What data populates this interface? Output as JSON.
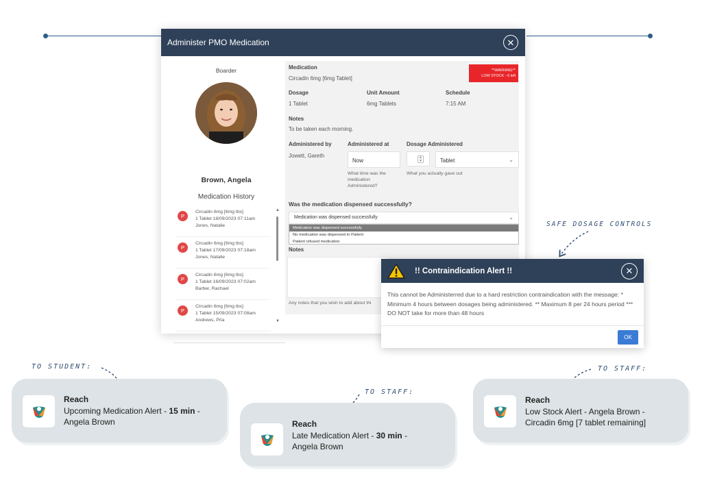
{
  "modal": {
    "title": "Administer PMO Medication",
    "close_icon": "close-icon",
    "boarder_label": "Boarder",
    "student_name": "Brown, Angela",
    "history_title": "Medication History",
    "history": [
      {
        "badge": "P",
        "line1": "Circadin 6mg [6mg tbs]",
        "line2": "1 Tablet 18/09/2023 07:11am",
        "line3": "Jones, Natalie"
      },
      {
        "badge": "P",
        "line1": "Circadin 6mg [6mg tbs]",
        "line2": "1 Tablet 17/09/2023 07:18am",
        "line3": "Jones, Natalie"
      },
      {
        "badge": "P",
        "line1": "Circadin 6mg [6mg tbs]",
        "line2": "1 Tablet 16/09/2023 07:02am",
        "line3": "Barber, Rachael"
      },
      {
        "badge": "P",
        "line1": "Circadin 6mg [6mg tbs]",
        "line2": "1 Tablet 15/09/2023 07:08am",
        "line3": "Andrews, Pria"
      }
    ],
    "medication_label": "Medication",
    "medication_value": "Circadin 6mg [6mg Tablet]",
    "warning_line1": "**WARNING**",
    "warning_line2": "LOW STOCK - 6 left",
    "dosage_label": "Dosage",
    "dosage_value": "1 Tablet",
    "unit_label": "Unit Amount",
    "unit_value": "6mg Tablets",
    "schedule_label": "Schedule",
    "schedule_value": "7:15 AM",
    "notes_label": "Notes",
    "notes_value": "To be taken each morning.",
    "admin_by_label": "Administered by",
    "admin_by_value": "Jowett, Gareth",
    "admin_at_label": "Administered at",
    "admin_at_value": "Now",
    "admin_at_hint": "What time was the medication Administered?",
    "dosage_admin_label": "Dosage Administered",
    "dosage_admin_unit": "Tablet",
    "dosage_admin_hint": "What you actually gave out",
    "dispensed_question": "Was the medication dispensed successfully?",
    "dispensed_selected": "Medication was dispensed successfully",
    "dispensed_options": [
      "Medication was dispensed successfully",
      "No medication was dispensed to Patient",
      "Patient refused medication"
    ],
    "notes2_label": "Notes",
    "notes2_hint": "Any notes that you wish to add about thi"
  },
  "alert": {
    "title": "!! Contraindication Alert !!",
    "icon": "warning-icon",
    "body": "This cannot be Administerred due to a hard restriction contraindication with the message: * Minimum 4 hours between dosages being administered. ** Maximum 8 per 24 hours period *** DO NOT take for more than 48 hours",
    "ok_label": "OK"
  },
  "annotations": {
    "safe_dosage": "SAFE DOSAGE CONTROLS",
    "to_student": "TO STUDENT:",
    "to_staff_1": "TO STAFF:",
    "to_staff_2": "TO STAFF:"
  },
  "notifications": [
    {
      "app": "Reach",
      "pre": "Upcoming Medication Alert - ",
      "bold": "15 min",
      "post": " -",
      "line2": "Angela Brown"
    },
    {
      "app": "Reach",
      "pre": "Late Medication Alert - ",
      "bold": "30 min",
      "post": " -",
      "line2": "Angela Brown"
    },
    {
      "app": "Reach",
      "pre": "Low Stock Alert - Angela Brown -",
      "bold": "",
      "post": "",
      "line2": "Circadin 6mg [7 tablet remaining]"
    }
  ],
  "colors": {
    "header": "#2f4159",
    "warning": "#e8262a",
    "badge": "#e14747",
    "ok": "#3a7bd5",
    "card": "#dde3e6"
  }
}
